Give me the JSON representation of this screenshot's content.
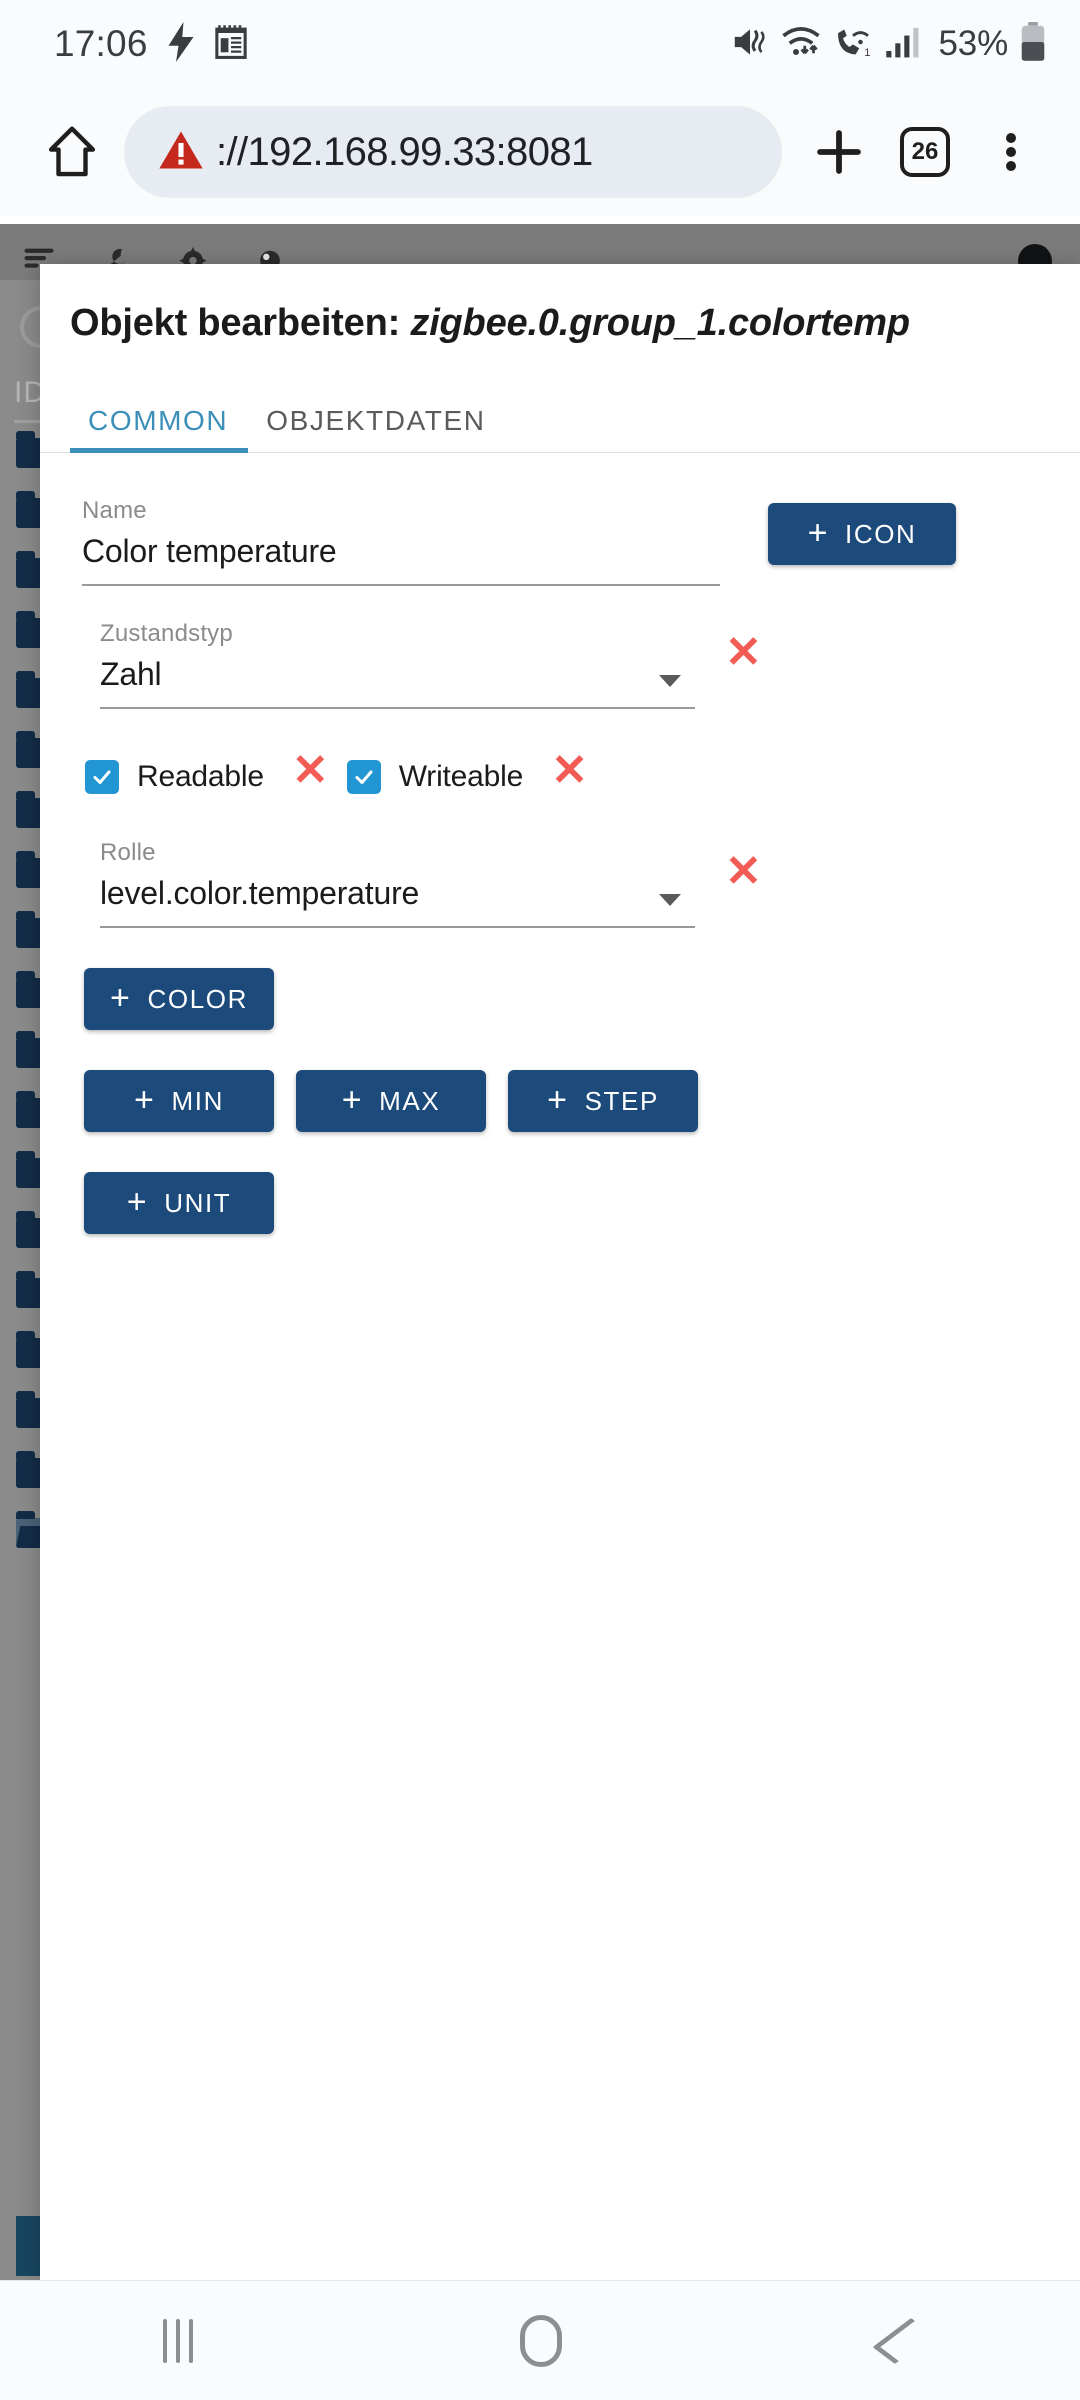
{
  "status_bar": {
    "time": "17:06",
    "battery_percent": "53%",
    "icons": [
      "bolt-charging-icon",
      "calendar-icon",
      "mute-vibrate-icon",
      "wifi-icon",
      "call-wifi-icon",
      "signal-bars-icon",
      "battery-icon"
    ]
  },
  "browser": {
    "home_icon": "home-icon",
    "security_icon": "warning-triangle-icon",
    "url": "://192.168.99.33:8081",
    "url_host": "://192.168.99.33",
    "url_port": ":8081",
    "new_tab_icon": "plus-icon",
    "tab_count": "26",
    "menu_icon": "kebab-menu-icon"
  },
  "background_page": {
    "toolbar_icons": [
      "menu-lines-icon",
      "wrench-icon",
      "gear-icon",
      "contrast-icon"
    ],
    "avatar": "user-avatar",
    "search_icon": "search-icon",
    "column_header": "ID",
    "folder_count": 20
  },
  "dialog": {
    "title_prefix": "Objekt bearbeiten: ",
    "object_id": "zigbee.0.group_1.colortemp",
    "tabs": [
      {
        "label": "COMMON",
        "active": true
      },
      {
        "label": "OBJEKTDATEN",
        "active": false
      }
    ],
    "fields": {
      "name": {
        "label": "Name",
        "value": "Color temperature"
      },
      "state_type": {
        "label": "Zustandstyp",
        "value": "Zahl"
      },
      "role": {
        "label": "Rolle",
        "value": "level.color.temperature"
      }
    },
    "checkboxes": [
      {
        "label": "Readable",
        "checked": true
      },
      {
        "label": "Writeable",
        "checked": true
      }
    ],
    "icon_button": "ICON",
    "add_buttons_row1": [
      "COLOR"
    ],
    "add_buttons_row2": [
      "MIN",
      "MAX",
      "STEP"
    ],
    "add_buttons_row3": [
      "UNIT"
    ],
    "plus_glyph": "+",
    "clear_glyph": "✕"
  },
  "nav_bar": {
    "recents": "recents-button",
    "home": "home-button",
    "back": "back-button"
  },
  "colors": {
    "primary_button": "#1c4a7a",
    "tab_active": "#3b8fb9",
    "checkbox": "#2196d3",
    "clear_x": "#f25c54",
    "url_pill": "#e6ecf2",
    "warning": "#c5281c"
  }
}
